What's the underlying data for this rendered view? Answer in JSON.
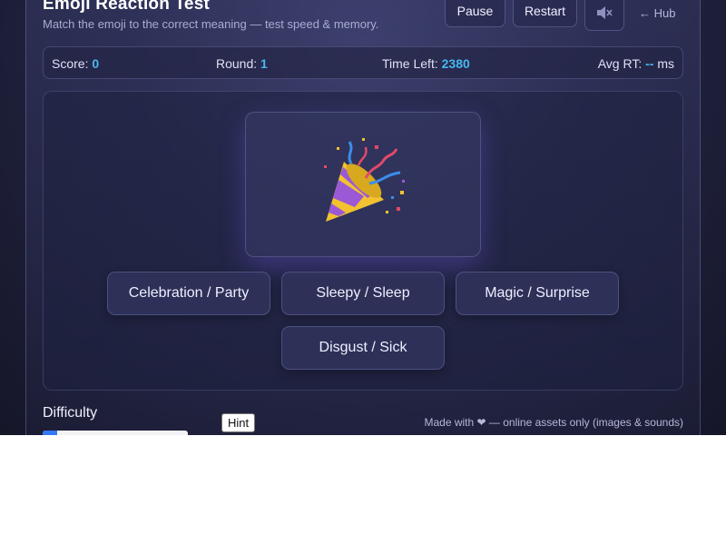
{
  "header": {
    "title": "Emoji Reaction Test",
    "subtitle": "Match the emoji to the correct meaning — test speed & memory.",
    "pause_label": "Pause",
    "restart_label": "Restart",
    "sound_icon": "speaker-muted-icon",
    "hub_label": "← Hub"
  },
  "stats": {
    "score_label": "Score:",
    "score_value": "0",
    "round_label": "Round:",
    "round_value": "1",
    "time_label": "Time Left:",
    "time_value": "2380",
    "avg_label": "Avg RT:",
    "avg_value": "--",
    "avg_unit": "ms"
  },
  "game": {
    "emoji": "party-popper-emoji",
    "answers": [
      "Celebration / Party",
      "Sleepy / Sleep",
      "Magic / Surprise",
      "Disgust / Sick"
    ]
  },
  "controls": {
    "difficulty_label": "Difficulty",
    "difficulty_level": 0.1,
    "hint_label": "Hint"
  },
  "footer": {
    "text": "Made with ❤ — online assets only (images & sounds)"
  },
  "colors": {
    "accent": "#47b7f0",
    "background": "#232544"
  }
}
